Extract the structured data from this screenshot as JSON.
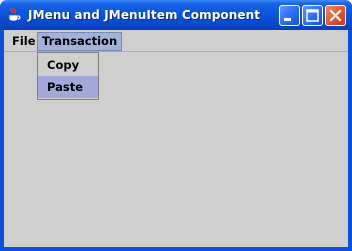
{
  "window": {
    "title": "JMenu and JMenuItem Component",
    "icon": "java-cup-icon",
    "controls": [
      "minimize-icon",
      "maximize-icon",
      "close-icon"
    ]
  },
  "menubar": {
    "menus": [
      {
        "label": "File"
      },
      {
        "label": "Transaction",
        "open": true
      }
    ]
  },
  "popup": {
    "items": [
      {
        "label": "Copy",
        "selected": false
      },
      {
        "label": "Paste",
        "selected": true
      }
    ]
  },
  "colors": {
    "titlebar": "#0a55dc",
    "client_bg": "#cfcfcf",
    "menu_highlight": "#a3b2d9",
    "item_selected": "#a3a7d9",
    "close_button": "#e3542c"
  }
}
